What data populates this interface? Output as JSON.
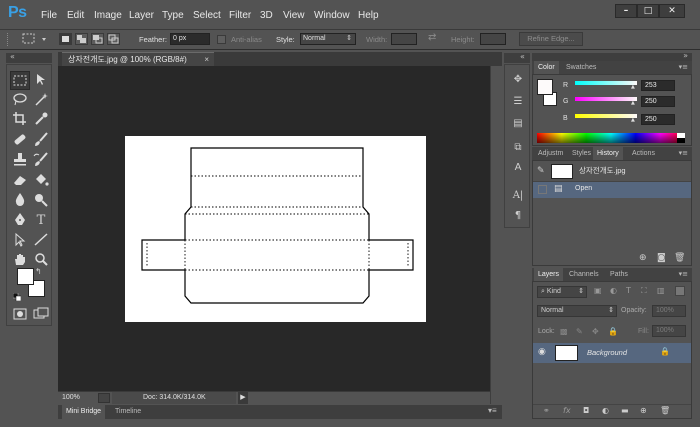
{
  "app": {
    "logo": "Ps"
  },
  "menu": [
    "File",
    "Edit",
    "Image",
    "Layer",
    "Type",
    "Select",
    "Filter",
    "3D",
    "View",
    "Window",
    "Help"
  ],
  "window_controls": {
    "minimize": "–",
    "maximize": "□",
    "close": "✕"
  },
  "options": {
    "feather_label": "Feather:",
    "feather_value": "0 px",
    "antialias_label": "Anti-alias",
    "style_label": "Style:",
    "style_value": "Normal",
    "width_label": "Width:",
    "height_label": "Height:",
    "refine_label": "Refine Edge..."
  },
  "document": {
    "tab_title": "상자전개도.jpg @ 100% (RGB/8#)",
    "close": "×",
    "zoom": "100%",
    "doc_info": "Doc: 314.0K/314.0K"
  },
  "bottom_tabs": [
    "Mini Bridge",
    "Timeline"
  ],
  "color_panel": {
    "tabs": [
      "Color",
      "Swatches"
    ],
    "channels": [
      {
        "label": "R",
        "value": "253"
      },
      {
        "label": "G",
        "value": "250"
      },
      {
        "label": "B",
        "value": "250"
      }
    ],
    "colors": {
      "r_gradient": "#00fdfa",
      "g_gradient": "#ff00ff",
      "b_gradient": "#ffff00"
    }
  },
  "history_panel": {
    "tabs": [
      "Adjustm",
      "Styles",
      "History",
      "Actions"
    ],
    "snapshot_name": "상자전개도.jpg",
    "states": [
      "Open"
    ]
  },
  "layers_panel": {
    "tabs": [
      "Layers",
      "Channels",
      "Paths"
    ],
    "filter_label": "Kind",
    "blend_mode": "Normal",
    "opacity_label": "Opacity:",
    "opacity_value": "100%",
    "lock_label": "Lock:",
    "fill_label": "Fill:",
    "fill_value": "100%",
    "layers": [
      {
        "name": "Background"
      }
    ]
  }
}
